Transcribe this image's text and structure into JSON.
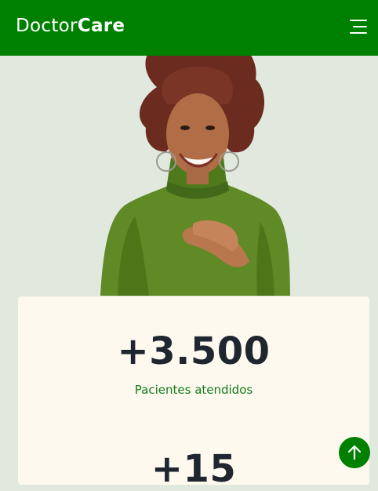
{
  "header": {
    "logo_light": "Doctor",
    "logo_bold": "Care",
    "menu_icon": "hamburger-menu-icon"
  },
  "hero": {
    "image": "woman-hands-on-chest-photo"
  },
  "stats": [
    {
      "value": "+3.500",
      "label": "Pacientes atendidos"
    },
    {
      "value": "+15",
      "label": ""
    }
  ],
  "scroll_top": {
    "icon": "arrow-up-icon"
  },
  "colors": {
    "brand_green": "#008000",
    "label_green": "#137b1b",
    "background": "#e1e9df",
    "card": "#fdf9ee",
    "value_text": "#1f2630"
  }
}
